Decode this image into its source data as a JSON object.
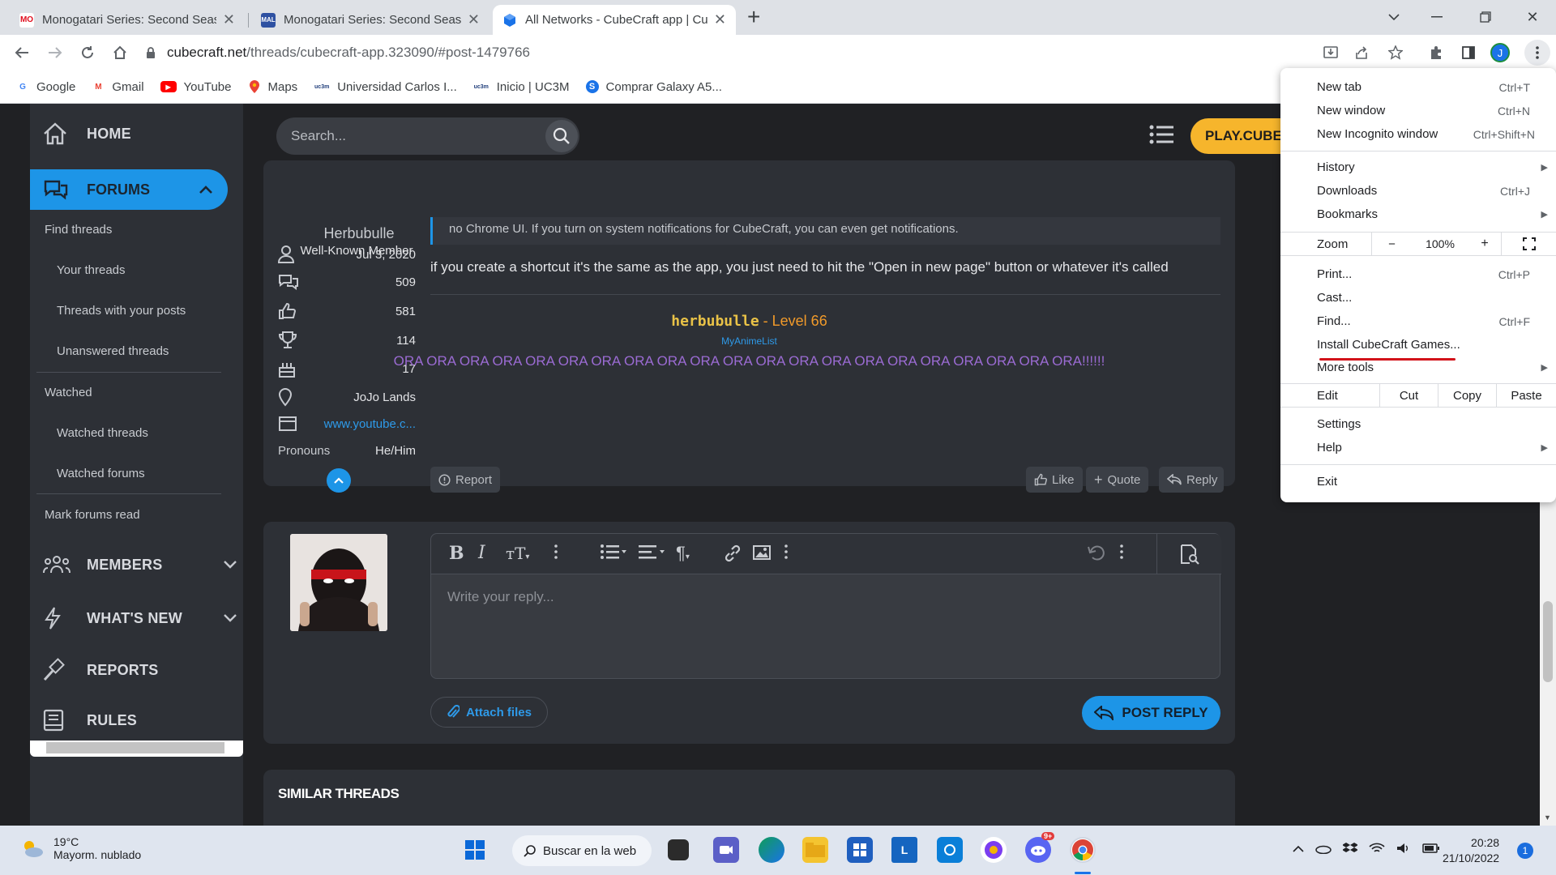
{
  "browser": {
    "tabs": [
      {
        "title": "Monogatari Series: Second Seaso",
        "favicon": "MO",
        "favicon_color": "#e10e1e"
      },
      {
        "title": "Monogatari Series: Second Seaso",
        "favicon": "MAL",
        "favicon_color": "#2e51a2"
      },
      {
        "title": "All Networks - CubeCraft app | Cu",
        "favicon": "cube",
        "favicon_color": "#1a73e8",
        "active": true
      }
    ],
    "url_host": "cubecraft.net",
    "url_path": "/threads/cubecraft-app.323090/#post-1479766",
    "profile_initial": "J",
    "bookmarks": [
      {
        "label": "Google",
        "icon": "G",
        "color": "#4285f4"
      },
      {
        "label": "Gmail",
        "icon": "M",
        "color": "#ea4335"
      },
      {
        "label": "YouTube",
        "icon": "▶",
        "color": "#ff0000"
      },
      {
        "label": "Maps",
        "icon": "⬤",
        "color": "#34a853"
      },
      {
        "label": "Universidad Carlos I...",
        "icon": "uc3m",
        "color": "#1f3d7a"
      },
      {
        "label": "Inicio | UC3M",
        "icon": "uc3m",
        "color": "#1f3d7a"
      },
      {
        "label": "Comprar Galaxy A5...",
        "icon": "S",
        "color": "#1a73e8"
      }
    ]
  },
  "menu": {
    "new_tab": "New tab",
    "new_tab_sc": "Ctrl+T",
    "new_window": "New window",
    "new_window_sc": "Ctrl+N",
    "incognito": "New Incognito window",
    "incognito_sc": "Ctrl+Shift+N",
    "history": "History",
    "downloads": "Downloads",
    "downloads_sc": "Ctrl+J",
    "bookmarks": "Bookmarks",
    "zoom": "Zoom",
    "zoom_minus": "−",
    "zoom_value": "100%",
    "zoom_plus": "+",
    "print": "Print...",
    "print_sc": "Ctrl+P",
    "cast": "Cast...",
    "find": "Find...",
    "find_sc": "Ctrl+F",
    "install": "Install CubeCraft Games...",
    "more_tools": "More tools",
    "edit": "Edit",
    "cut": "Cut",
    "copy": "Copy",
    "paste": "Paste",
    "settings": "Settings",
    "help": "Help",
    "exit": "Exit"
  },
  "sidebar": {
    "home": "HOME",
    "forums": "FORUMS",
    "find_threads": "Find threads",
    "your_threads": "Your threads",
    "threads_with_posts": "Threads with your posts",
    "unanswered": "Unanswered threads",
    "watched": "Watched",
    "watched_threads": "Watched threads",
    "watched_forums": "Watched forums",
    "mark_read": "Mark forums read",
    "members": "MEMBERS",
    "whats_new": "WHAT'S NEW",
    "reports": "REPORTS",
    "rules": "RULES"
  },
  "header": {
    "search_placeholder": "Search...",
    "play": "PLAY.CUBECRAFT.NET"
  },
  "post": {
    "username": "Herbubulle",
    "user_title": "Well-Known Member",
    "joined": "Jul 3, 2020",
    "messages": "509",
    "reactions": "581",
    "trophies": "114",
    "age": "17",
    "location": "JoJo Lands",
    "website": "www.youtube.c...",
    "pronouns_label": "Pronouns",
    "pronouns": "He/Him",
    "quote_text": "no Chrome UI. If you turn on system notifications for CubeCraft, you can even get notifications.",
    "text": "if you create a shortcut it's the same as the app, you just need to hit the \"Open in new page\" button or whatever it's called",
    "sig_user": "herbubulle",
    "sig_level": " - Level 66",
    "sig_link": "MyAnimeList",
    "sig_ora": "ORA ORA ORA ORA ORA ORA ORA ORA ORA ORA ORA ORA ORA ORA ORA ORA ORA ORA ORA ORA ORA!!!!!!",
    "report": "Report",
    "like": "Like",
    "quote": "Quote",
    "reply": "Reply"
  },
  "reply_box": {
    "placeholder": "Write your reply...",
    "attach": "Attach files",
    "post_reply": "POST REPLY"
  },
  "similar": {
    "title": "SIMILAR THREADS"
  },
  "taskbar": {
    "temp": "19°C",
    "weather": "Mayorm. nublado",
    "search": "Buscar en la web",
    "time": "20:28",
    "date": "21/10/2022",
    "notifications": "1",
    "discord_badge": "9+"
  }
}
